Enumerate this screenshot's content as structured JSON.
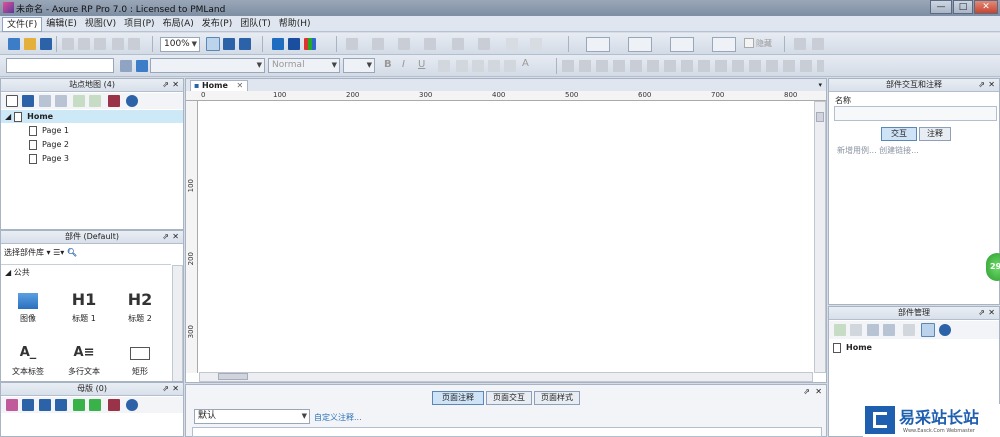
{
  "window": {
    "title": "未命名 - Axure RP Pro 7.0 : Licensed to PMLand",
    "min": "—",
    "max": "□",
    "close": "✕"
  },
  "menu": [
    "文件(F)",
    "编辑(E)",
    "视图(V)",
    "项目(P)",
    "布局(A)",
    "发布(P)",
    "团队(T)",
    "帮助(H)"
  ],
  "toolbar": {
    "zoom": "100%",
    "font_style": "Normal",
    "hide_label": "隐藏"
  },
  "sitemap": {
    "title": "站点地图 (4)",
    "root": "Home",
    "pages": [
      "Page 1",
      "Page 2",
      "Page 3"
    ]
  },
  "widgets": {
    "title": "部件 (Default)",
    "select_library": "选择部件库",
    "group": "公共",
    "items": [
      {
        "glyph": "",
        "label": "图像",
        "icon": "image-icon"
      },
      {
        "glyph": "H1",
        "label": "标题 1",
        "icon": "h1-icon"
      },
      {
        "glyph": "H2",
        "label": "标题 2",
        "icon": "h2-icon"
      },
      {
        "glyph": "A_",
        "label": "文本标签",
        "icon": "text-label-icon"
      },
      {
        "glyph": "A≡",
        "label": "多行文本",
        "icon": "paragraph-icon"
      },
      {
        "glyph": "",
        "label": "矩形",
        "icon": "rectangle-icon"
      }
    ]
  },
  "masters": {
    "title": "母版 (0)"
  },
  "canvas": {
    "tab": "Home",
    "hruler": [
      "0",
      "100",
      "200",
      "300",
      "400",
      "500",
      "600",
      "700",
      "800"
    ],
    "vruler": [
      "100",
      "200",
      "300"
    ]
  },
  "page_notes": {
    "tabs": [
      "页面注释",
      "页面交互",
      "页面样式"
    ],
    "select": "默认",
    "custom_link": "自定义注释..."
  },
  "interaction": {
    "title": "部件交互和注释",
    "name_label": "名称",
    "tabs": [
      "交互",
      "注释"
    ],
    "links": "新增用例...  创建链接..."
  },
  "widget_manager": {
    "title": "部件管理",
    "item": "Home"
  },
  "watermark": {
    "text": "易采站长站",
    "sub": "Www.Easck.Com Webmaster"
  },
  "badge": "29",
  "colors": {
    "accent": "#2b72b8",
    "green": "#3ab24a",
    "selection": "#cde8f7"
  }
}
